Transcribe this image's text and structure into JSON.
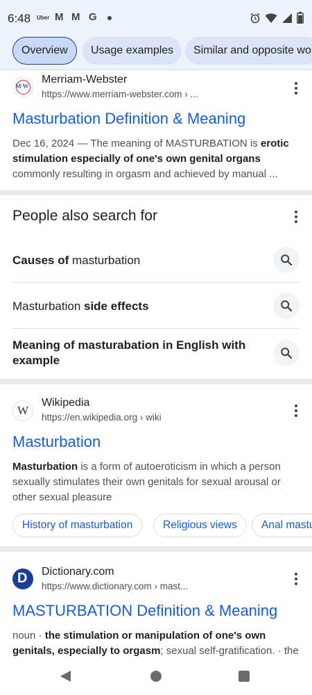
{
  "status_bar": {
    "time": "6:48",
    "uber_label": "Uber",
    "gmail_glyph_1": "M",
    "gmail_glyph_2": "M",
    "google_glyph": "G"
  },
  "tabs": [
    {
      "label": "Overview",
      "active": true
    },
    {
      "label": "Usage examples",
      "active": false
    },
    {
      "label": "Similar and opposite wo",
      "active": false
    }
  ],
  "results": [
    {
      "site_name": "Merriam-Webster",
      "url": "https://www.merriam-webster.com › ...",
      "favicon_text": "M·W",
      "title": "Masturbation Definition & Meaning",
      "snippet_date": "Dec 16, 2024 — The meaning of MASTURBATION is ",
      "snippet_bold": "erotic stimulation especially of one's own genital organs",
      "snippet_rest": " commonly resulting in orgasm and achieved by manual ..."
    },
    {
      "site_name": "Wikipedia",
      "url": "https://en.wikipedia.org › wiki",
      "favicon_text": "W",
      "title": "Masturbation",
      "snippet_bold": "Masturbation",
      "snippet_rest": " is a form of autoeroticism in which a person sexually stimulates their own genitals for sexual arousal or other sexual pleasure",
      "chips": [
        "History of masturbation",
        "Religious views",
        "Anal mastu"
      ]
    },
    {
      "site_name": "Dictionary.com",
      "url": "https://www.dictionary.com › mast...",
      "favicon_text": "D",
      "title": "MASTURBATION Definition & Meaning",
      "snippet_prefix": "noun · ",
      "snippet_bold": "the stimulation or manipulation of one's own genitals, especially to orgasm",
      "snippet_rest": "; sexual self-gratification. · the"
    }
  ],
  "people_also_search": {
    "title": "People also search for",
    "items": [
      {
        "bold_1": "Causes of",
        "plain_1": " masturbation",
        "bold_2": "",
        "plain_2": ""
      },
      {
        "bold_1": "",
        "plain_1": "Masturbation ",
        "bold_2": "side effects",
        "plain_2": ""
      },
      {
        "bold_1": "Meaning of masturabation in English with example",
        "plain_1": "",
        "bold_2": "",
        "plain_2": ""
      }
    ]
  },
  "icons": {
    "kebab": "more-vert-icon",
    "search": "search-icon",
    "nav_back": "back-triangle-icon",
    "nav_home": "home-circle-icon",
    "nav_recent": "recents-square-icon"
  },
  "colors": {
    "link": "#1a5bd0",
    "status_bg": "#eef2fa",
    "tab_bg": "#dbe4f7",
    "divider": "#e8eaed"
  }
}
